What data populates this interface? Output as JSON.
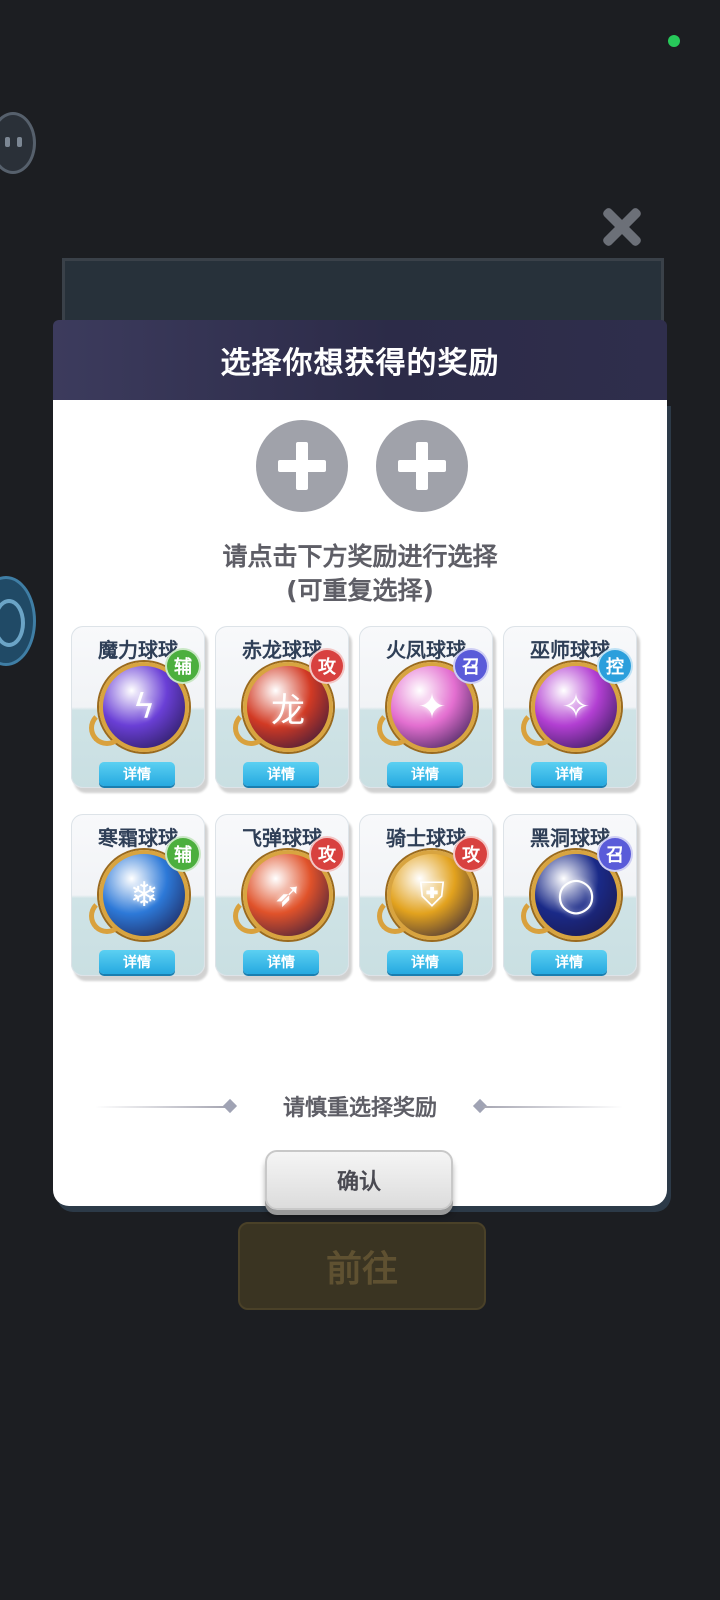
{
  "background": {
    "go_button_label": "前往"
  },
  "dialog": {
    "title": "选择你想获得的奖励",
    "hint_line1": "请点击下方奖励进行选择",
    "hint_line2": "(可重复选择)",
    "caution": "请慎重选择奖励",
    "confirm_label": "确认"
  },
  "rewards": [
    {
      "name": "魔力球球",
      "tag": "辅",
      "tag_color": "#4caf3e",
      "orb_color": "#6a3fd6",
      "icon": "lightning-icon",
      "detail_label": "详情"
    },
    {
      "name": "赤龙球球",
      "tag": "攻",
      "tag_color": "#d8413f",
      "orb_color": "#d23a24",
      "icon": "dragon-icon",
      "detail_label": "详情"
    },
    {
      "name": "火凤球球",
      "tag": "召",
      "tag_color": "#5a5bd9",
      "orb_color": "#e36fd0",
      "icon": "phoenix-icon",
      "detail_label": "详情"
    },
    {
      "name": "巫师球球",
      "tag": "控",
      "tag_color": "#2b9fdc",
      "orb_color": "#b23fd2",
      "icon": "wizard-icon",
      "detail_label": "详情"
    },
    {
      "name": "寒霜球球",
      "tag": "辅",
      "tag_color": "#4caf3e",
      "orb_color": "#2d79d8",
      "icon": "ice-crystal-icon",
      "detail_label": "详情"
    },
    {
      "name": "飞弹球球",
      "tag": "攻",
      "tag_color": "#d8413f",
      "orb_color": "#e0522a",
      "icon": "missile-icon",
      "detail_label": "详情"
    },
    {
      "name": "骑士球球",
      "tag": "攻",
      "tag_color": "#d8413f",
      "orb_color": "#e2a21e",
      "icon": "knight-helmet-icon",
      "detail_label": "详情"
    },
    {
      "name": "黑洞球球",
      "tag": "召",
      "tag_color": "#5a5bd9",
      "orb_color": "#1a2a88",
      "icon": "black-hole-icon",
      "detail_label": "详情"
    }
  ]
}
